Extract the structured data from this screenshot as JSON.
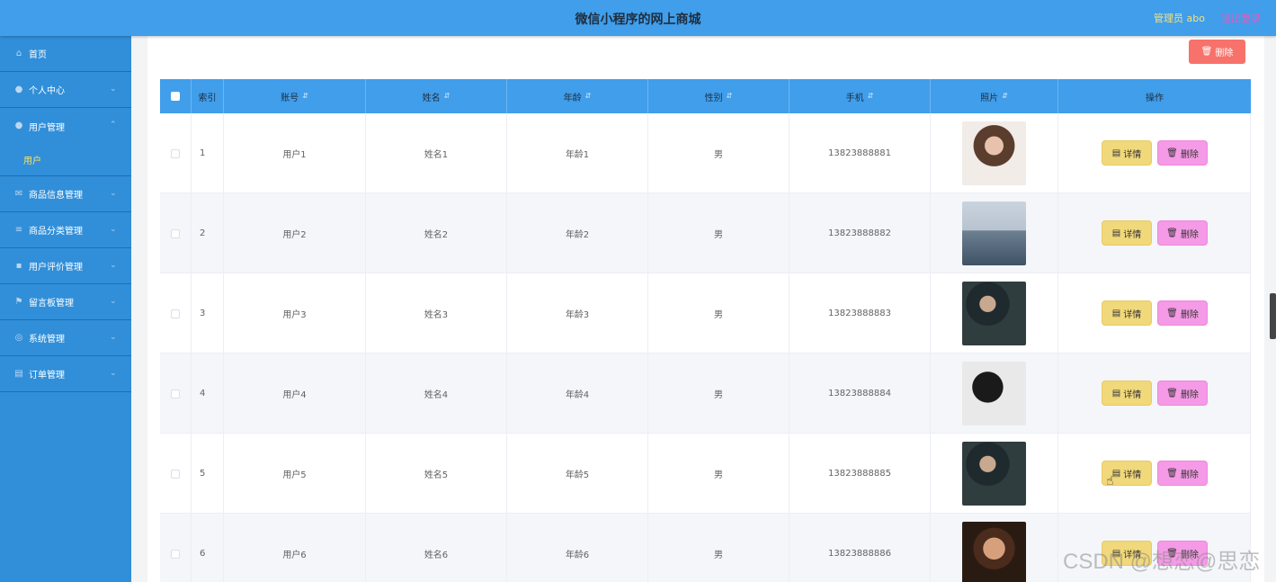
{
  "header": {
    "title": "微信小程序的网上商城",
    "admin_label": "管理员 abo",
    "logout_label": "退出登录"
  },
  "sidebar": {
    "items": [
      {
        "label": "首页",
        "icon": "home-icon"
      },
      {
        "label": "个人中心",
        "icon": "user-icon"
      },
      {
        "label": "用户管理",
        "icon": "user-icon",
        "expanded": true,
        "children": [
          "用户"
        ]
      },
      {
        "label": "商品信息管理",
        "icon": "mail-icon"
      },
      {
        "label": "商品分类管理",
        "icon": "list-icon"
      },
      {
        "label": "用户评价管理",
        "icon": "comment-icon"
      },
      {
        "label": "留言板管理",
        "icon": "flag-icon"
      },
      {
        "label": "系统管理",
        "icon": "globe-icon"
      },
      {
        "label": "订单管理",
        "icon": "clipboard-icon"
      }
    ]
  },
  "toolbar": {
    "delete_label": "删除"
  },
  "table": {
    "columns": [
      "索引",
      "账号",
      "姓名",
      "年龄",
      "性别",
      "手机",
      "照片",
      "操作"
    ],
    "rows": [
      {
        "index": "1",
        "account": "用户1",
        "name": "姓名1",
        "age": "年龄1",
        "gender": "男",
        "phone": "13823888881"
      },
      {
        "index": "2",
        "account": "用户2",
        "name": "姓名2",
        "age": "年龄2",
        "gender": "男",
        "phone": "13823888882"
      },
      {
        "index": "3",
        "account": "用户3",
        "name": "姓名3",
        "age": "年龄3",
        "gender": "男",
        "phone": "13823888883"
      },
      {
        "index": "4",
        "account": "用户4",
        "name": "姓名4",
        "age": "年龄4",
        "gender": "男",
        "phone": "13823888884"
      },
      {
        "index": "5",
        "account": "用户5",
        "name": "姓名5",
        "age": "年龄5",
        "gender": "男",
        "phone": "13823888885"
      },
      {
        "index": "6",
        "account": "用户6",
        "name": "姓名6",
        "age": "年龄6",
        "gender": "男",
        "phone": "13823888886"
      }
    ],
    "detail_label": "详情",
    "delete_label": "删除"
  },
  "watermark": "CSDN @想恋@思恋",
  "colors": {
    "header_bg": "#409eeb",
    "sidebar_bg": "#318fd9",
    "active_submenu": "#ffe25c",
    "delete_top": "#f7726b",
    "detail_button": "#f1d87a",
    "delete_button": "#f59ae6"
  }
}
